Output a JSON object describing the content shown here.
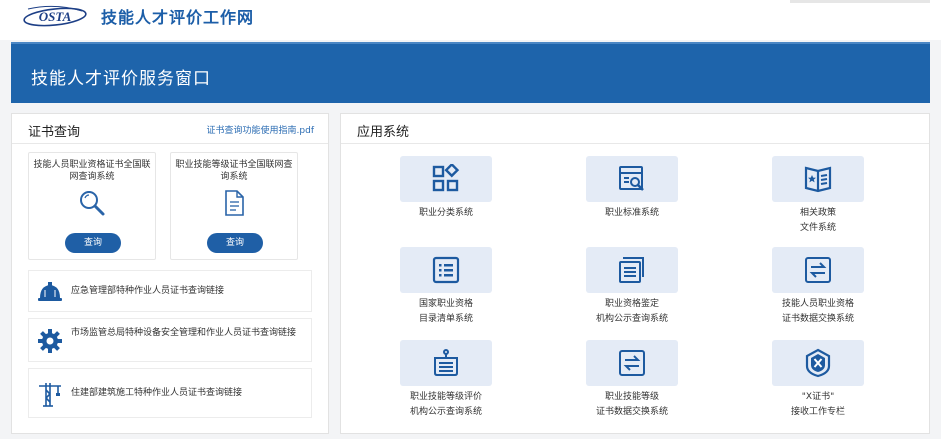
{
  "header": {
    "logo_text": "OSTA",
    "site_name": "技能人才评价工作网"
  },
  "banner": {
    "title": "技能人才评价服务窗口"
  },
  "cert_query": {
    "title": "证书查询",
    "guide_link": "证书查询功能使用指南.pdf",
    "cards": [
      {
        "title": "技能人员职业资格证书全国联网查询系统",
        "icon": "search-magnifier-icon",
        "button": "查询"
      },
      {
        "title": "职业技能等级证书全国联网查询系统",
        "icon": "document-icon",
        "button": "查询"
      }
    ],
    "links": [
      {
        "text": "应急管理部特种作业人员证书查询链接",
        "icon": "safety-helmet-icon"
      },
      {
        "text": "市场监管总局特种设备安全管理和作业人员证书查询链接",
        "icon": "gear-icon"
      },
      {
        "text": "住建部建筑施工特种作业人员证书查询链接",
        "icon": "tower-crane-icon"
      }
    ]
  },
  "apps": {
    "title": "应用系统",
    "items": [
      {
        "label": "职业分类系统",
        "icon": "category-grid-icon"
      },
      {
        "label": "职业标准系统",
        "icon": "standard-search-icon"
      },
      {
        "label": "相关政策\n文件系统",
        "icon": "policy-book-icon"
      },
      {
        "label": "国家职业资格\n目录清单系统",
        "icon": "list-icon"
      },
      {
        "label": "职业资格鉴定\n机构公示查询系统",
        "icon": "documents-icon"
      },
      {
        "label": "技能人员职业资格\n证书数据交换系统",
        "icon": "exchange-icon"
      },
      {
        "label": "职业技能等级评价\n机构公示查询系统",
        "icon": "organization-icon"
      },
      {
        "label": "职业技能等级\n证书数据交换系统",
        "icon": "exchange-icon"
      },
      {
        "label": "\"X证书\"\n接收工作专栏",
        "icon": "x-shield-icon"
      }
    ]
  },
  "colors": {
    "primary": "#1e64ab",
    "tile_bg": "#e4ebf6",
    "icon": "#1d5aa0"
  }
}
